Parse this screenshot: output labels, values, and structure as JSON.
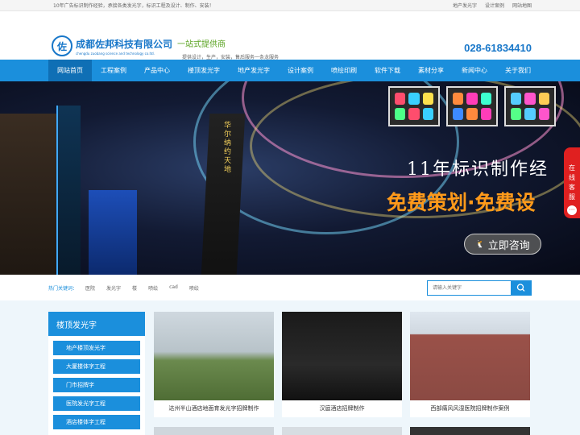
{
  "topbar": {
    "tagline": "10年广告标识制作经验，承接各类发光字，标识工程及设计、制作、安装！",
    "links": [
      "地产发光字",
      "设计案例",
      "网站地图"
    ]
  },
  "header": {
    "logo_emblem": "佐",
    "company_name": "成都佐邦科技有限公司",
    "company_en": "chengdu zuobang science and technology co.ltd.",
    "slogan_title": "一站式提供商",
    "slogan_sub": "提供设计，生产，安装，售后服务一条龙服务",
    "phone": "028-61834410"
  },
  "nav": {
    "items": [
      "网站首页",
      "工程案例",
      "产品中心",
      "楼顶发光字",
      "地产发光字",
      "设计案例",
      "喷绘印刷",
      "软件下载",
      "素材分享",
      "新闻中心",
      "关于我们"
    ],
    "active_index": 0
  },
  "banner": {
    "tower_text": "华尔纳约天地",
    "headline": "11年标识制作经",
    "subheadline": "免费策划·免费设",
    "consult_label": "立即咨询",
    "consult_icon": "qq-icon"
  },
  "float_service": {
    "label_chars": [
      "在",
      "线",
      "客",
      "服"
    ],
    "icon": "chat-icon"
  },
  "search": {
    "hot_label": "热门关键词：",
    "keywords": [
      "医院",
      "发光字",
      "楼",
      "喷绘",
      "cad",
      "喷绘"
    ],
    "placeholder": "请输入关键字",
    "button_icon": "search-icon"
  },
  "sidebar": {
    "title": "楼顶发光字",
    "items": [
      "地产楼顶发光字",
      "大厦楼体字工程",
      "门市招牌字",
      "医院发光字工程",
      "酒店楼体字工程"
    ]
  },
  "products": [
    {
      "caption": "达州半山酒店地面育发光字招牌制作"
    },
    {
      "caption": "汉庭酒店招牌制作"
    },
    {
      "caption": "西部痛风风湿医院招牌制作案例"
    },
    {
      "caption": ""
    },
    {
      "caption": ""
    },
    {
      "caption": ""
    }
  ],
  "colors": {
    "brand_blue": "#1b8fdc",
    "nav_active": "#0f6fb5",
    "slogan_green": "#5aa321",
    "service_red": "#e02020"
  }
}
